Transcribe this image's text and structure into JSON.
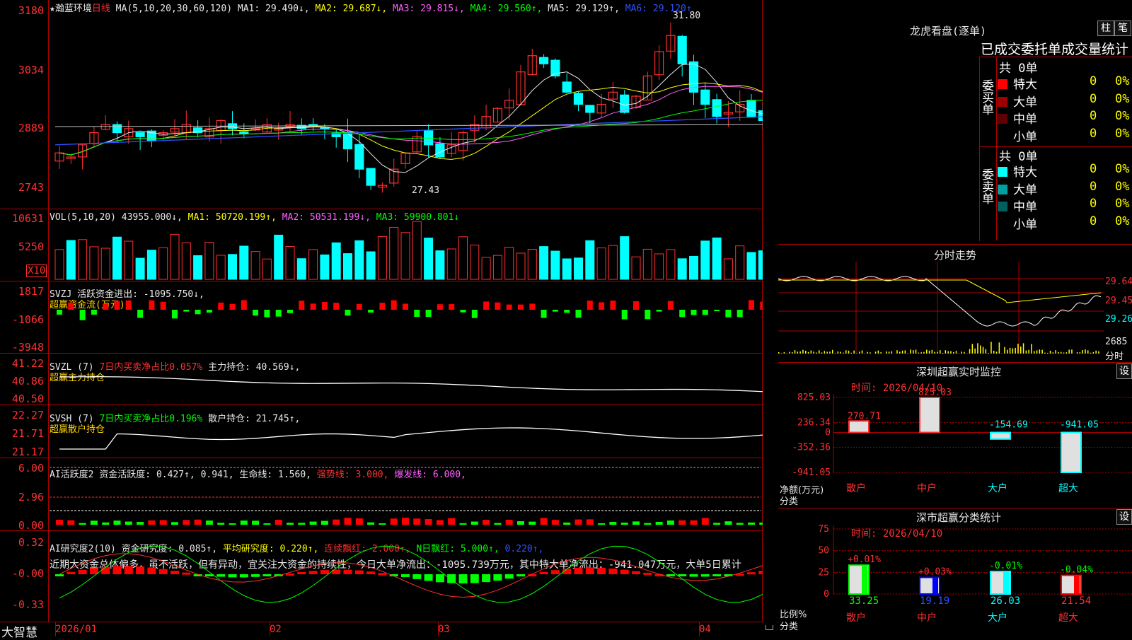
{
  "stock": {
    "name": "★瀚蓝环境",
    "period": "日线"
  },
  "ma_header": {
    "params": "MA(5,10,20,30,60,120)",
    "ma1": "MA1: 29.490↓,",
    "ma2": "MA2: 29.687↓,",
    "ma3": "MA3: 29.815↓,",
    "ma4": "MA4: 29.560↑,",
    "ma5": "MA5: 29.129↑,",
    "ma6": "MA6: 29.120↑"
  },
  "price_axis": [
    "3180",
    "3034",
    "2889",
    "2743"
  ],
  "price_marks": {
    "high": "31.80",
    "low": "27.43"
  },
  "vol_header": {
    "label": "VOL(5,10,20)",
    "vol": "43955.000↓,",
    "ma1": "MA1: 50720.199↑,",
    "ma2": "MA2: 50531.199↓,",
    "ma3": "MA3: 59900.801↓"
  },
  "vol_axis": [
    "10631",
    "5250"
  ],
  "vol_unit": "X10",
  "svzj": {
    "label": "SVZJ  活跃资金进出: -1095.750↓,",
    "sub": "超赢资金流(万元)",
    "axis": [
      "1817",
      "-1066",
      "-3948"
    ]
  },
  "svzl": {
    "label": "SVZL (7) ",
    "pct": "7日内买卖净占比0.057%",
    "hold": " 主力持仓: 40.569↓,",
    "sub": "超赢主力持仓",
    "axis": [
      "41.22",
      "40.86",
      "40.50"
    ]
  },
  "svsh": {
    "label": "SVSH (7) ",
    "pct": "7日内买卖净占比0.196%",
    "hold": " 散户持仓: 21.745↑,",
    "sub": "超赢散户持仓",
    "axis": [
      "22.27",
      "21.71",
      "21.17"
    ]
  },
  "ai_act": {
    "label": "AI活跃度2 资金活跃度: 0.427↑, 0.941, 生命线: 1.560,",
    "strong": " 强势线: 3.000,",
    "burst": " 爆发线: 6.000,",
    "axis": [
      "6.00",
      "2.96",
      "0.00"
    ]
  },
  "ai_res": {
    "label": "AI研究度2(10) 资金研究度: 0.085↑,",
    "avg": " 平均研究度: 0.220↑,",
    "cont": " 连续飘红: 2.000↑,",
    "nday": " N日飘红: 5.000↑,",
    "last": " 0.220↑,",
    "axis": [
      "0.32",
      "-0.00",
      "-0.33"
    ],
    "comment": "近期大资金总体偏多，虽不活跃，但有异动，宜关注大资金的持续性，今日大单净流出：-1095.739万元，其中特大单净流出：-941.047万元，大单5日累计"
  },
  "date_axis": [
    "2026/01",
    "02",
    "03",
    "04"
  ],
  "brand": "大智慧",
  "dragon": {
    "title": "龙虎看盘(逐单)",
    "btn1": "柱",
    "btn2": "笔",
    "header": "已成交委托单成交量统计",
    "buy_label": "委买单",
    "sell_label": "委卖单",
    "buy_total": "共 0单",
    "sell_total": "共 0单",
    "buy_rows": [
      {
        "name": "特大",
        "val": "0",
        "pct": "0%",
        "color": "#ff0000"
      },
      {
        "name": "大单",
        "val": "0",
        "pct": "0%",
        "color": "#a00000"
      },
      {
        "name": "中单",
        "val": "0",
        "pct": "0%",
        "color": "#600000"
      },
      {
        "name": "小单",
        "val": "0",
        "pct": "0%",
        "color": ""
      }
    ],
    "sell_rows": [
      {
        "name": "特大",
        "val": "0",
        "pct": "0%",
        "color": "#00ffff"
      },
      {
        "name": "大单",
        "val": "0",
        "pct": "0%",
        "color": "#00a0a0"
      },
      {
        "name": "中单",
        "val": "0",
        "pct": "0%",
        "color": "#006060"
      },
      {
        "name": "小单",
        "val": "0",
        "pct": "0%",
        "color": ""
      }
    ]
  },
  "intraday": {
    "title": "分时走势",
    "axis": [
      "29.64",
      "29.45",
      "29.26",
      "2685"
    ],
    "unit": "分时"
  },
  "monitor": {
    "title": "深圳超赢实时监控",
    "btn": "设",
    "time": "时间: 2026/04/10",
    "axis": [
      "825.03",
      "236.34",
      "0",
      "-352.36",
      "-941.05"
    ],
    "ylabel": "净额(万元)",
    "xlabel": "分类",
    "cats": [
      "散户",
      "中户",
      "大户",
      "超大"
    ],
    "values": [
      270.71,
      825.03,
      -154.69,
      -941.05
    ],
    "labels": [
      "270.71",
      "825.03",
      "-154.69",
      "-941.05"
    ]
  },
  "classify": {
    "title": "深市超赢分类统计",
    "btn": "设",
    "time": "时间: 2026/04/10",
    "axis": [
      "75",
      "50",
      "25",
      "0"
    ],
    "ylabel": "比例%",
    "xlabel": "分类",
    "cats": [
      "散户",
      "中户",
      "大户",
      "超大"
    ],
    "values": [
      33.25,
      19.19,
      26.03,
      21.54
    ],
    "labels": [
      "33.25",
      "19.19",
      "26.03",
      "21.54"
    ],
    "deltas": [
      "+0.01%",
      "+0.03%",
      "-0.01%",
      "-0.04%"
    ]
  },
  "colors": {
    "up": "#ff3030",
    "down": "#00ffff",
    "grid": "#a00000"
  }
}
